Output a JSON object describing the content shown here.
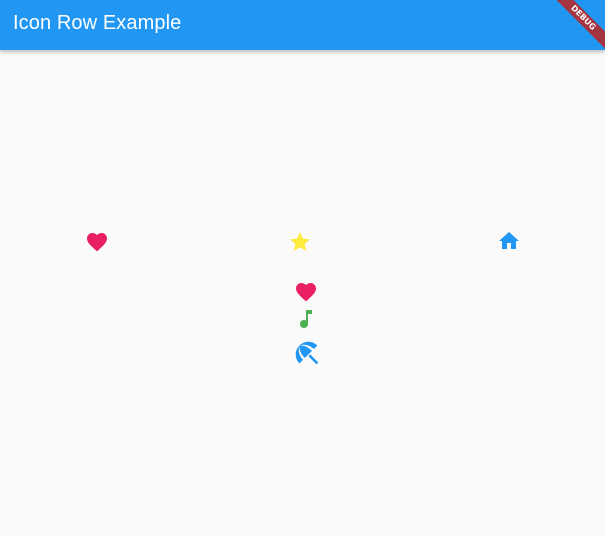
{
  "app": {
    "title": "Icon Row Example",
    "debug_label": "DEBUG",
    "primary_color": "#2196f3"
  },
  "row_icons": [
    {
      "name": "heart-icon",
      "color": "#e91e63"
    },
    {
      "name": "star-icon",
      "color": "#ffeb3b"
    },
    {
      "name": "home-icon",
      "color": "#2196f3"
    }
  ],
  "column_icons": [
    {
      "name": "heart-icon",
      "color": "#e91e63"
    },
    {
      "name": "music-note-icon",
      "color": "#4caf50"
    },
    {
      "name": "beach-umbrella-icon",
      "color": "#2196f3"
    }
  ]
}
